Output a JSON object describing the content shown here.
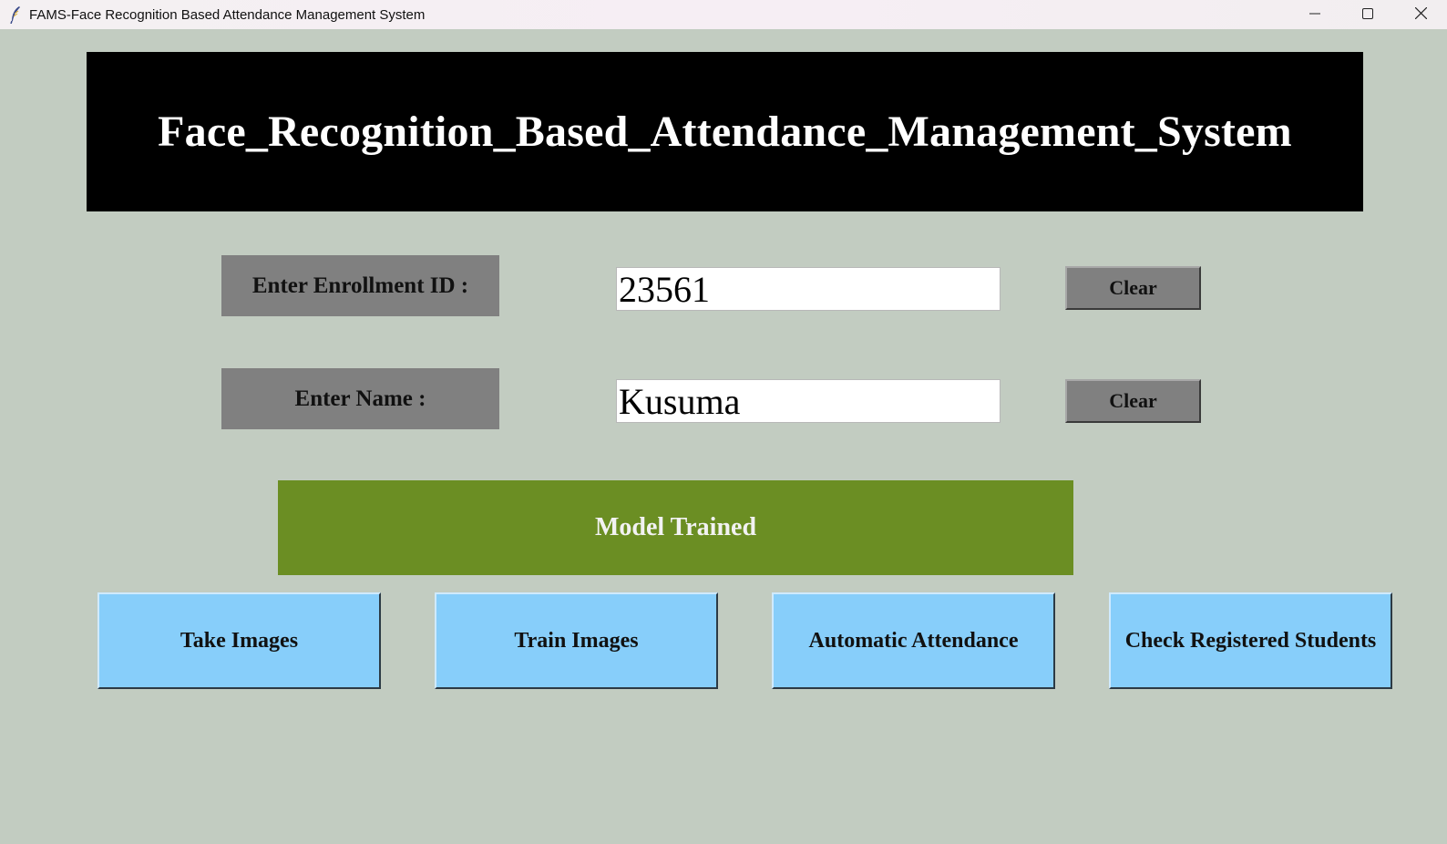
{
  "window": {
    "title": "FAMS-Face Recognition Based Attendance Management System",
    "icons": {
      "app": "feather-icon",
      "minimize": "minimize-icon",
      "maximize": "maximize-icon",
      "close": "close-icon"
    }
  },
  "header": {
    "title": "Face_Recognition_Based_Attendance_Management_System"
  },
  "form": {
    "enrollment": {
      "label": "Enter Enrollment ID :",
      "value": "23561",
      "clear_label": "Clear"
    },
    "name": {
      "label": "Enter Name :",
      "value": "Kusuma",
      "clear_label": "Clear"
    }
  },
  "status": {
    "message": "Model Trained",
    "color": "#6b8e23"
  },
  "actions": [
    {
      "label": "Take Images"
    },
    {
      "label": "Train Images"
    },
    {
      "label": "Automatic Attendance"
    },
    {
      "label": "Check Registered Students"
    }
  ],
  "colors": {
    "background": "#c2ccc1",
    "header_bg": "#000000",
    "label_bg": "#808080",
    "action_bg": "#87cefa"
  }
}
